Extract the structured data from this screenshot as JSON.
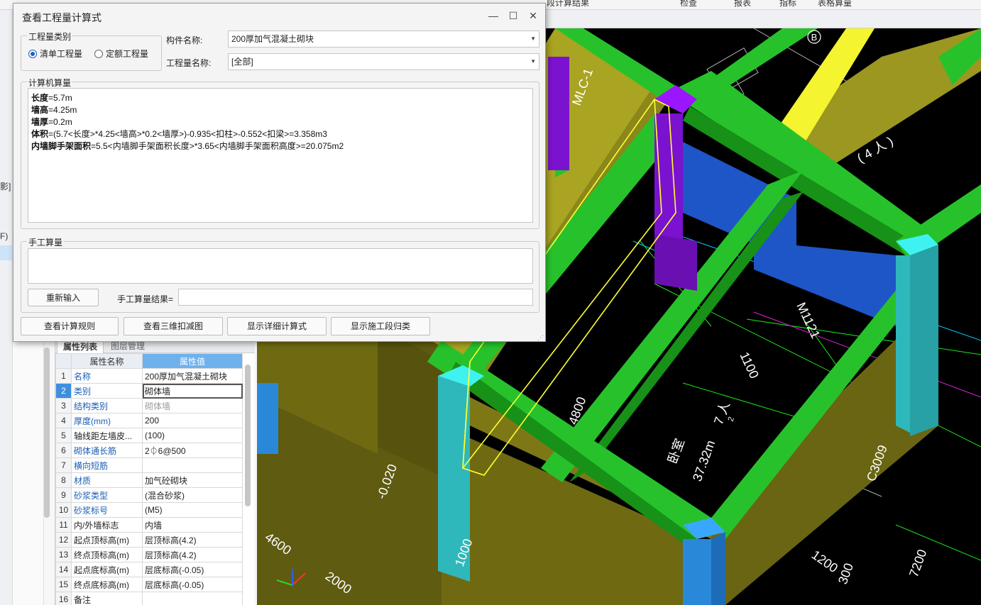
{
  "app": {
    "top_strip": [
      "…",
      "…",
      "…",
      "…",
      "段计算结果",
      "检查",
      "报表",
      "指标",
      "表格算量"
    ],
    "left_fragments": [
      "影]",
      "F)"
    ]
  },
  "dialog": {
    "title": "查看工程量计算式",
    "window_buttons": {
      "minimize": "—",
      "maximize": "☐",
      "close": "✕"
    },
    "category_group": "工程量类别",
    "radio_list": "清单工程量",
    "radio_quota": "定额工程量",
    "selected_radio": "清单工程量",
    "component_label": "构件名称:",
    "component_value": "200厚加气混凝土砌块",
    "quantity_label": "工程量名称:",
    "quantity_value": "[全部]",
    "computed_group": "计算机算量",
    "computed_lines": [
      {
        "name": "长度",
        "expr": "=5.7m"
      },
      {
        "name": "墙高",
        "expr": "=4.25m"
      },
      {
        "name": "墙厚",
        "expr": "=0.2m"
      },
      {
        "name": "体积",
        "expr": "=(5.7<长度>*4.25<墙高>*0.2<墙厚>)-0.935<扣柱>-0.552<扣梁>=3.358m3"
      },
      {
        "name": "内墙脚手架面积",
        "expr": "=5.5<内墙脚手架面积长度>*3.65<内墙脚手架面积高度>=20.075m2"
      }
    ],
    "manual_group": "手工算量",
    "reinput_button": "重新输入",
    "manual_result_label": "手工算量结果=",
    "manual_result_value": "",
    "buttons": {
      "rules": "查看计算规则",
      "deduct3d": "查看三维扣减图",
      "detail": "显示详细计算式",
      "segment": "显示施工段归类"
    }
  },
  "properties": {
    "tabs": [
      "属性列表",
      "图层管理"
    ],
    "header_name": "属性名称",
    "header_value": "属性值",
    "selected_row": 2,
    "rows": [
      {
        "num": "1",
        "name": "名称",
        "value": "200厚加气混凝土砌块",
        "name_color": "blue",
        "value_color": "normal"
      },
      {
        "num": "2",
        "name": "类别",
        "value": "砌体墙",
        "name_color": "blue",
        "value_color": "normal"
      },
      {
        "num": "3",
        "name": "结构类别",
        "value": "砌体墙",
        "name_color": "blue",
        "value_color": "gray"
      },
      {
        "num": "4",
        "name": "厚度(mm)",
        "value": "200",
        "name_color": "blue",
        "value_color": "normal"
      },
      {
        "num": "5",
        "name": "轴线距左墙皮...",
        "value": "(100)",
        "name_color": "normal",
        "value_color": "normal"
      },
      {
        "num": "6",
        "name": "砌体通长筋",
        "value": "2⏀6@500",
        "name_color": "blue",
        "value_color": "normal"
      },
      {
        "num": "7",
        "name": "横向短筋",
        "value": "",
        "name_color": "blue",
        "value_color": "normal"
      },
      {
        "num": "8",
        "name": "材质",
        "value": "加气砼砌块",
        "name_color": "blue",
        "value_color": "normal"
      },
      {
        "num": "9",
        "name": "砂浆类型",
        "value": "(混合砂浆)",
        "name_color": "blue",
        "value_color": "normal"
      },
      {
        "num": "10",
        "name": "砂浆标号",
        "value": "(M5)",
        "name_color": "blue",
        "value_color": "normal"
      },
      {
        "num": "11",
        "name": "内/外墙标志",
        "value": "内墙",
        "name_color": "normal",
        "value_color": "normal"
      },
      {
        "num": "12",
        "name": "起点顶标高(m)",
        "value": "层顶标高(4.2)",
        "name_color": "normal",
        "value_color": "normal"
      },
      {
        "num": "13",
        "name": "终点顶标高(m)",
        "value": "层顶标高(4.2)",
        "name_color": "normal",
        "value_color": "normal"
      },
      {
        "num": "14",
        "name": "起点底标高(m)",
        "value": "层底标高(-0.05)",
        "name_color": "normal",
        "value_color": "normal"
      },
      {
        "num": "15",
        "name": "终点底标高(m)",
        "value": "层底标高(-0.05)",
        "name_color": "normal",
        "value_color": "normal"
      },
      {
        "num": "16",
        "name": "备注",
        "value": "",
        "name_color": "normal",
        "value_color": "normal"
      }
    ]
  },
  "viewport": {
    "labels": {
      "axis_b": "B",
      "mlc": "MLC-1",
      "m1121": "M1121",
      "d1100": "1100",
      "d4800": "4800",
      "room": "卧室",
      "area": "37.32m",
      "sup2": "2",
      "n7": "7 人",
      "c3009": "C3009",
      "d4600": "4600",
      "d2000": "2000",
      "d1000": "1000",
      "d1200": "1200",
      "d300": "300",
      "d7200": "7200",
      "elev": "-0.020",
      "n4": "( 4 人 )"
    },
    "colors": {
      "beam": "#27c22b",
      "beam_dark": "#179117",
      "wall_olive": "#6f6a12",
      "wall_yellow": "#a9a421",
      "column_cyan": "#33d9d9",
      "column_purple": "#7b12cf",
      "blue_wall": "#1e56c8",
      "highlight": "#ffff33"
    }
  }
}
